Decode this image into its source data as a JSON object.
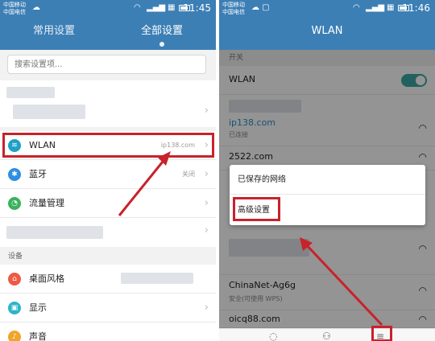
{
  "left": {
    "status": {
      "carrier_top": "中国移动",
      "carrier_bottom": "中国电信",
      "time": "11:45"
    },
    "tabs": [
      {
        "label": "常用设置",
        "active": false
      },
      {
        "label": "全部设置",
        "active": true
      }
    ],
    "search": {
      "placeholder": "搜索设置项..."
    },
    "rows": [
      {
        "id": "wlan",
        "label": "WLAN",
        "value": "ip138.com",
        "icon": "wifi-icon",
        "color": "#21a0c7"
      },
      {
        "id": "bluetooth",
        "label": "蓝牙",
        "value": "关闭",
        "icon": "bluetooth-icon",
        "color": "#2f8fe0"
      },
      {
        "id": "traffic",
        "label": "流量管理",
        "value": "",
        "icon": "data-usage-icon",
        "color": "#3bb25c"
      }
    ],
    "section_device": "设备",
    "device_rows": [
      {
        "id": "theme",
        "label": "桌面风格",
        "icon": "home-icon",
        "color": "#ee5a44"
      },
      {
        "id": "display",
        "label": "显示",
        "icon": "display-icon",
        "color": "#2bb5c9"
      },
      {
        "id": "sound",
        "label": "声音",
        "icon": "sound-icon",
        "color": "#f1a42b"
      }
    ]
  },
  "right": {
    "status": {
      "carrier_top": "中国移动",
      "carrier_bottom": "中国电信",
      "time": "11:46"
    },
    "title": "WLAN",
    "section_switch": "开关",
    "wlan_toggle": {
      "label": "WLAN",
      "on": true
    },
    "networks": [
      {
        "name": "ip138.com",
        "sub": "已连接",
        "connected": true
      },
      {
        "name": "2522.com",
        "sub": "",
        "connected": false
      },
      {
        "name": "ChinaNet-Ag6g",
        "sub": "安全(可使用 WPS)",
        "connected": false
      },
      {
        "name": "oicq88.com",
        "sub": "",
        "connected": false
      }
    ],
    "menu": {
      "saved": "已保存的网络",
      "advanced": "高级设置"
    }
  },
  "colors": {
    "header": "#3c7fb5",
    "highlight": "#c8222b",
    "toggle": "#3ba7a2"
  }
}
